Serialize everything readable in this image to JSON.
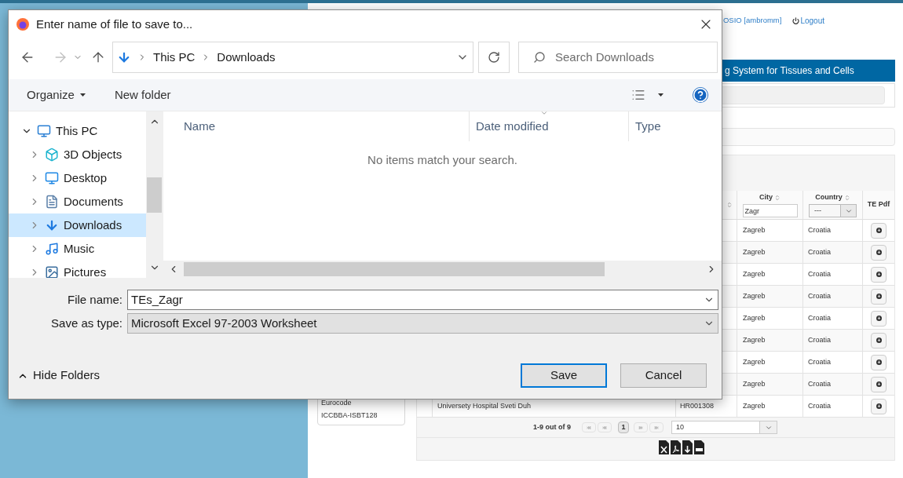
{
  "browser_page": {
    "user": "OSIO [ambromm]",
    "logout": "Logout",
    "banner": "g System for Tissues and Cells",
    "sidebar": [
      "Eurocode",
      "ICCBBA-ISBT128"
    ],
    "table": {
      "columns": [
        "City",
        "Country",
        "TE Pdf"
      ],
      "city_filter": "Zagr",
      "country_filter": "---",
      "rows": [
        {
          "name": "",
          "code": "",
          "city": "Zagreb",
          "country": "Croatia"
        },
        {
          "name": "",
          "code": "",
          "city": "Zagreb",
          "country": "Croatia"
        },
        {
          "name": "",
          "code": "",
          "city": "Zagreb",
          "country": "Croatia"
        },
        {
          "name": "",
          "code": "",
          "city": "Zagreb",
          "country": "Croatia"
        },
        {
          "name": "",
          "code": "",
          "city": "Zagreb",
          "country": "Croatia"
        },
        {
          "name": "",
          "code": "",
          "city": "Zagreb",
          "country": "Croatia"
        },
        {
          "name": "",
          "code": "",
          "city": "Zagreb",
          "country": "Croatia"
        },
        {
          "name": "",
          "code": "",
          "city": "Zagreb",
          "country": "Croatia"
        },
        {
          "name": "Universety Hospital Sveti Duh",
          "code": "HR001308",
          "city": "Zagreb",
          "country": "Croatia"
        }
      ]
    },
    "pagination": {
      "summary": "1-9 out of 9",
      "pages": [
        {
          "label": "1",
          "selected": true
        }
      ],
      "page_size": "10"
    }
  },
  "dialog": {
    "title": "Enter name of file to save to...",
    "breadcrumb": [
      "This PC",
      "Downloads"
    ],
    "search": {
      "placeholder": "Search Downloads"
    },
    "toolbar": {
      "organize": "Organize",
      "new_folder": "New folder"
    },
    "tree": [
      {
        "label": "This PC",
        "kind": "pc",
        "expanded": true,
        "selected": false,
        "children": [
          {
            "label": "3D Objects",
            "kind": "cube",
            "expanded": false,
            "selected": false
          },
          {
            "label": "Desktop",
            "kind": "desktop",
            "expanded": false,
            "selected": false
          },
          {
            "label": "Documents",
            "kind": "documents",
            "expanded": false,
            "selected": false
          },
          {
            "label": "Downloads",
            "kind": "downloads",
            "expanded": false,
            "selected": true
          },
          {
            "label": "Music",
            "kind": "music",
            "expanded": false,
            "selected": false
          },
          {
            "label": "Pictures",
            "kind": "pictures",
            "expanded": false,
            "selected": false
          }
        ]
      }
    ],
    "columns": [
      "Name",
      "Date modified",
      "Type"
    ],
    "empty_message": "No items match your search.",
    "file_name": {
      "label": "File name:",
      "value": "TEs_Zagr"
    },
    "save_type": {
      "label": "Save as type:",
      "value": "Microsoft Excel 97-2003 Worksheet"
    },
    "hide_folders": "Hide Folders",
    "buttons": [
      {
        "label": "Save",
        "default": true
      },
      {
        "label": "Cancel",
        "default": false
      }
    ]
  }
}
